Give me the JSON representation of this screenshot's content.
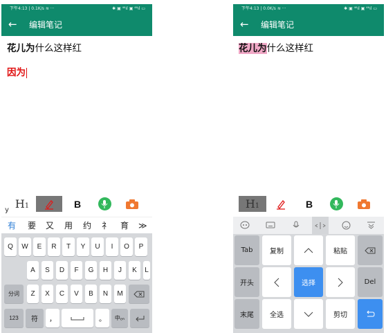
{
  "left": {
    "status": {
      "left": "下午4:13 | 0.1K/s ≋  ···",
      "right": "✱ ▣ ⁴⁶ıl ▣ ⁴⁶ıl ▭"
    },
    "title": "编辑笔记",
    "note": {
      "bold_text": "花儿为",
      "rest_text": "什么这样红",
      "red_text": "因为"
    },
    "format": {
      "h1": "H",
      "h1_sub": "1",
      "y_mark": "y",
      "bold": "B"
    },
    "candidates": [
      "有",
      "要",
      "又",
      "用",
      "约",
      "礻",
      "育",
      "≫"
    ],
    "rows": {
      "row1": [
        "Q",
        "W",
        "E",
        "R",
        "T",
        "Y",
        "U",
        "I",
        "O",
        "P"
      ],
      "row2": [
        "A",
        "S",
        "D",
        "F",
        "G",
        "H",
        "J",
        "K",
        "L"
      ],
      "row3": [
        "Z",
        "X",
        "C",
        "V",
        "B",
        "N",
        "M"
      ]
    },
    "keys": {
      "fenci": "分词",
      "num": "123",
      "fu": "符",
      "comma": "，",
      "dot": "。",
      "zhongying": "中ₑₙ"
    }
  },
  "right": {
    "status": {
      "left": "下午4:13 | 0.0K/s ≋  ···",
      "right": "✱ ▣ ⁴⁶ıl ▣ ⁴⁶ıl ▭"
    },
    "title": "编辑笔记",
    "note": {
      "bold_text": "花儿为",
      "rest_text": "什么这样红"
    },
    "format": {
      "h1": "H",
      "h1_sub": "1",
      "bold": "B"
    },
    "edit_keys": {
      "tab": "Tab",
      "copy": "复制",
      "paste": "粘贴",
      "start": "开头",
      "select": "选择",
      "del": "Del",
      "end": "末尾",
      "select_all": "全选",
      "cut": "剪切"
    }
  },
  "colors": {
    "app_bar": "#0f8a6c",
    "highlight": "#f0a8c6",
    "red_text": "#e01010",
    "accent_blue": "#3d8ff0",
    "mic_green": "#32b85c"
  }
}
